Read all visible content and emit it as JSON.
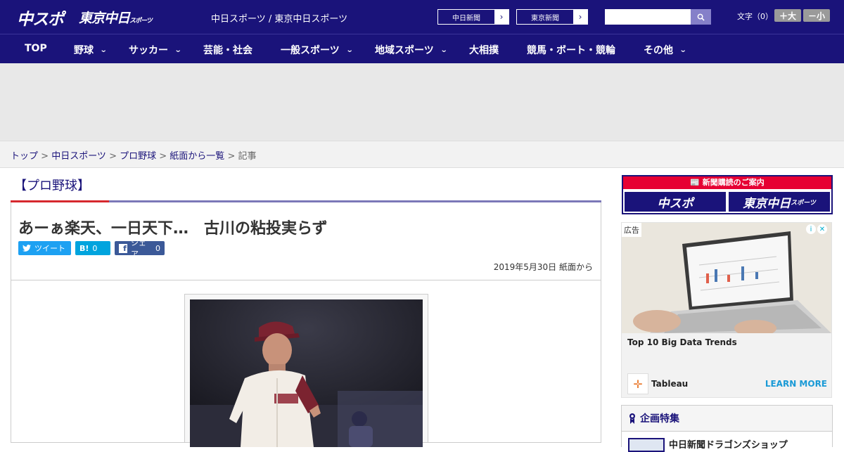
{
  "header": {
    "logo_chuspo": "中スポ",
    "logo_tokyo": "東京中日",
    "logo_tokyo_small": "スポーツ",
    "site_title": "中日スポーツ / 東京中日スポーツ",
    "paper_links": [
      {
        "label": "中日新聞"
      },
      {
        "label": "東京新聞"
      }
    ],
    "search_placeholder": "",
    "fontsize_label": "文字（0）",
    "fontsize_plus": "＋大",
    "fontsize_minus": "－小"
  },
  "nav": {
    "items": [
      {
        "label": "TOP",
        "has_menu": false
      },
      {
        "label": "野球",
        "has_menu": true
      },
      {
        "label": "サッカー",
        "has_menu": true
      },
      {
        "label": "芸能・社会",
        "has_menu": false
      },
      {
        "label": "一般スポーツ",
        "has_menu": true
      },
      {
        "label": "地域スポーツ",
        "has_menu": true
      },
      {
        "label": "大相撲",
        "has_menu": false
      },
      {
        "label": "競馬・ボート・競輪",
        "has_menu": false
      },
      {
        "label": "その他",
        "has_menu": true
      }
    ]
  },
  "breadcrumbs": {
    "items": [
      "トップ",
      "中日スポーツ",
      "プロ野球",
      "紙面から一覧"
    ],
    "current": "記事",
    "separator": " > "
  },
  "article": {
    "category": "【プロ野球】",
    "headline": "あーぁ楽天、一日天下…　古川の粘投実らず",
    "share": {
      "tweet": "ツイート",
      "hatena_label": "B!",
      "hatena_count": "0",
      "facebook_label": "シェア",
      "facebook_count": "0"
    },
    "date": "2019年5月30日 紙面から"
  },
  "sidebar": {
    "subscribe_header": "新聞購読のご案内",
    "subscribe_chuspo": "中スポ",
    "subscribe_tokyo": "東京中日",
    "subscribe_tokyo_small": "スポーツ",
    "ad": {
      "tag": "広告",
      "title": "Top 10 Big Data Trends",
      "brand": "Tableau",
      "cta": "LEARN MORE"
    },
    "feature": {
      "title": "企画特集",
      "item": "中日新聞ドラゴンズショップ"
    }
  },
  "colors": {
    "brand_navy": "#1a137a",
    "accent_red": "#d6282e",
    "accent_purple": "#7b78b8",
    "twitter": "#1da1f2",
    "hatena": "#00a4de",
    "facebook": "#3b5998"
  }
}
